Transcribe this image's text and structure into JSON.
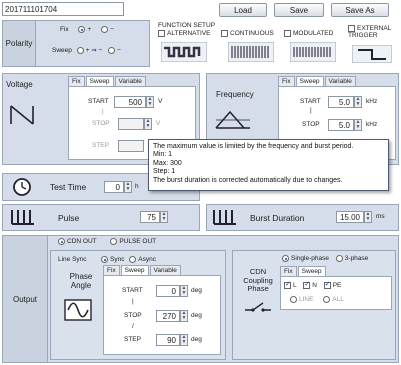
{
  "header": {
    "id_text": "201711101704",
    "function_setup_label": "FUNCTION SETUP",
    "buttons": {
      "load": "Load",
      "save": "Save",
      "save_as": "Save As"
    },
    "modes": {
      "alternative": "ALTERNATIVE",
      "continuous": "CONTINUOUS",
      "modulated": "MODULATED",
      "external_trigger": "EXTERNAL TRIGGER"
    }
  },
  "polarity": {
    "label": "Polarity",
    "fix_label": "Fix",
    "fix_plus": "+",
    "fix_minus": "−",
    "sweep_label": "Sweep",
    "sweep_plus_minus": "+ ⇒ −",
    "sweep_minus_plus": "−"
  },
  "voltage": {
    "label": "Voltage",
    "tabs": [
      "Fix",
      "Sweep",
      "Variable"
    ],
    "start_label": "START",
    "start_value": "500",
    "unit": "V",
    "stop_label": "STOP",
    "step_label": "STEP"
  },
  "frequency": {
    "label": "Frequency",
    "tabs": [
      "Fix",
      "Sweep",
      "Variable"
    ],
    "start_label": "START",
    "start_value": "5.0",
    "stop_label": "STOP",
    "stop_value": "5.0",
    "unit": "kHz"
  },
  "tooltip": {
    "line1": "The maximum value is limited by the frequency and burst period.",
    "line2": "Min: 1",
    "line3": "Max: 300",
    "line4": "Step: 1",
    "line5": "The burst duration is corrected automatically due to changes."
  },
  "test_time": {
    "label": "Test Time",
    "value": "0",
    "unit": "h"
  },
  "pulse": {
    "label": "Pulse",
    "value": "75"
  },
  "burst_duration": {
    "label": "Burst Duration",
    "value": "15.00",
    "unit": "ms"
  },
  "output": {
    "label": "Output",
    "cdn_out": "CDN OUT",
    "pulse_out": "PULSE OUT",
    "line_sync_label": "Line Sync",
    "sync": "Sync",
    "async": "Async",
    "phase_angle_label": "Phase Angle",
    "tabs": [
      "Fix",
      "Sweep",
      "Variable"
    ],
    "start_label": "START",
    "start_value": "0",
    "stop_label": "STOP",
    "stop_value": "270",
    "step_label": "STEP",
    "step_value": "90",
    "unit": "deg",
    "cdn_coupling_label": "CDN Coupling Phase",
    "single_phase": "Single-phase",
    "three_phase": "3-phase",
    "coupling_tabs": [
      "Fix",
      "Sweep"
    ],
    "chk_l": "L",
    "chk_n": "N",
    "chk_pe": "PE",
    "line_opt": "LINE",
    "all_opt": "ALL"
  }
}
